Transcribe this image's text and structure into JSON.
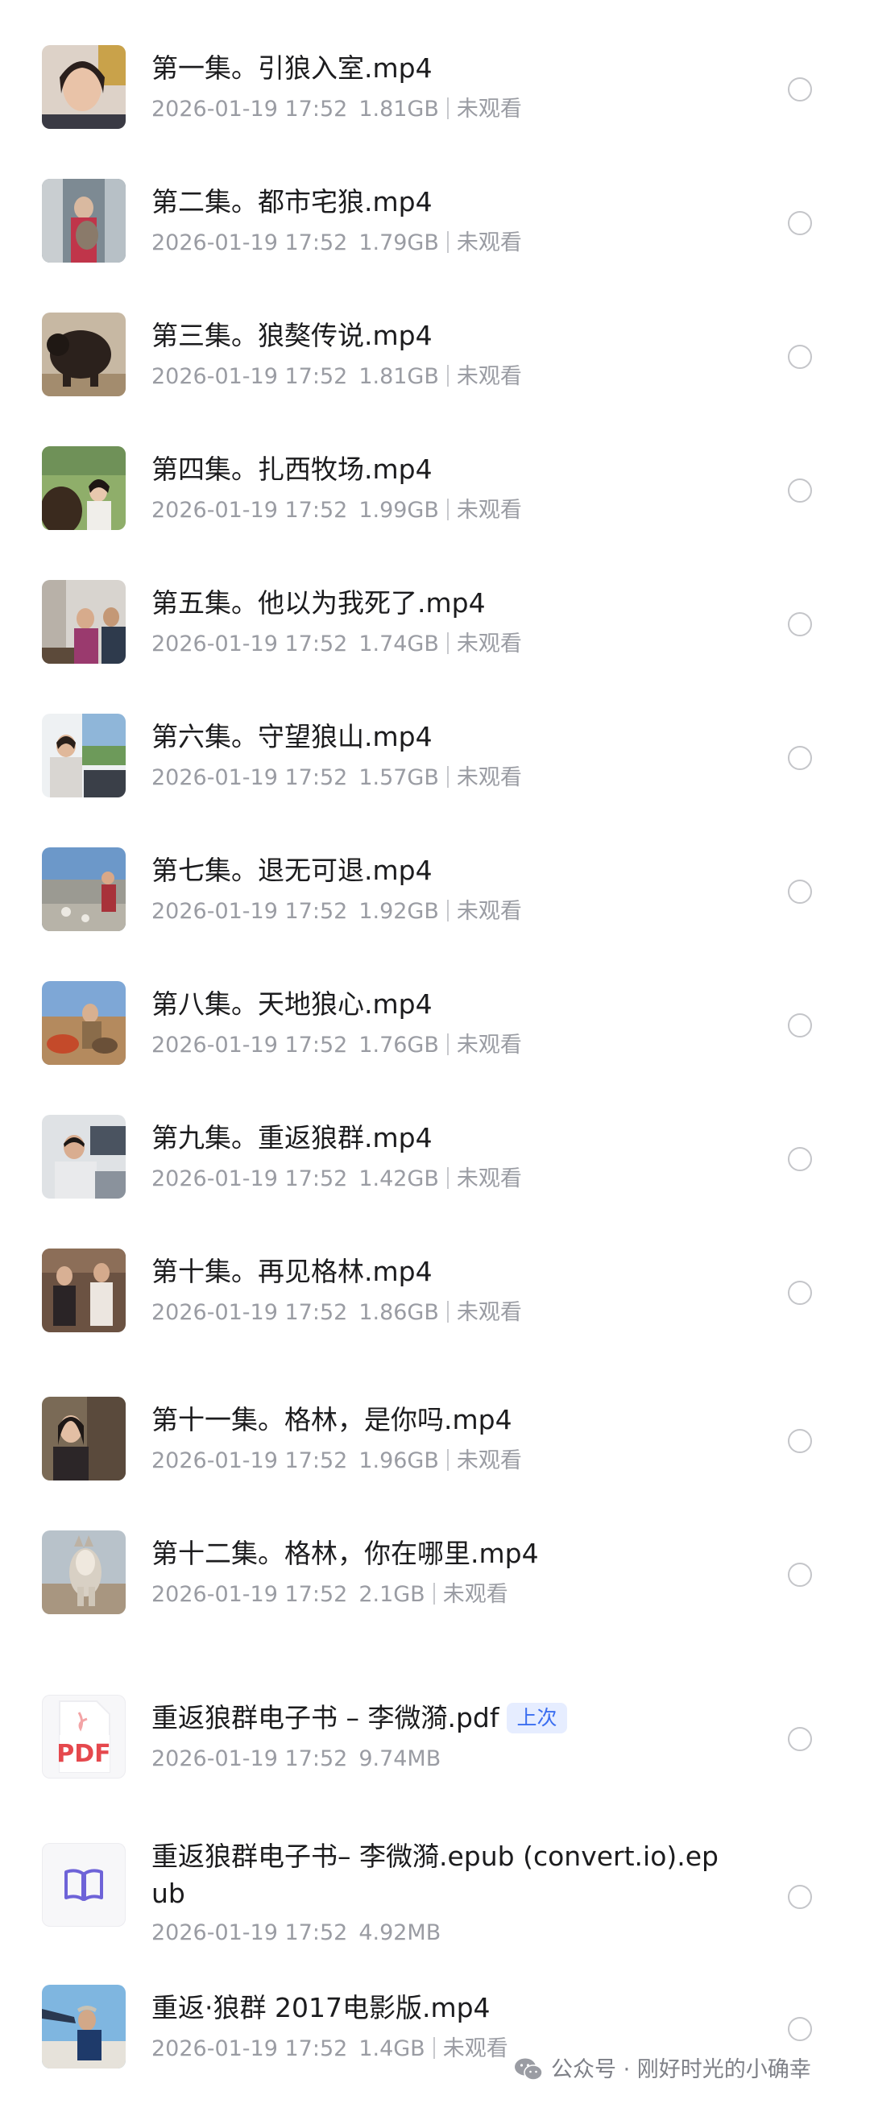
{
  "files": [
    {
      "title": "第一集。引狼入室.mp4",
      "date": "2026-01-19 17:52",
      "size": "1.81GB",
      "status": "未观看"
    },
    {
      "title": "第二集。都市宅狼.mp4",
      "date": "2026-01-19 17:52",
      "size": "1.79GB",
      "status": "未观看"
    },
    {
      "title": "第三集。狼獒传说.mp4",
      "date": "2026-01-19 17:52",
      "size": "1.81GB",
      "status": "未观看"
    },
    {
      "title": "第四集。扎西牧场.mp4",
      "date": "2026-01-19 17:52",
      "size": "1.99GB",
      "status": "未观看"
    },
    {
      "title": "第五集。他以为我死了.mp4",
      "date": "2026-01-19 17:52",
      "size": "1.74GB",
      "status": "未观看"
    },
    {
      "title": "第六集。守望狼山.mp4",
      "date": "2026-01-19 17:52",
      "size": "1.57GB",
      "status": "未观看"
    },
    {
      "title": "第七集。退无可退.mp4",
      "date": "2026-01-19 17:52",
      "size": "1.92GB",
      "status": "未观看"
    },
    {
      "title": "第八集。天地狼心.mp4",
      "date": "2026-01-19 17:52",
      "size": "1.76GB",
      "status": "未观看"
    },
    {
      "title": "第九集。重返狼群.mp4",
      "date": "2026-01-19 17:52",
      "size": "1.42GB",
      "status": "未观看"
    },
    {
      "title": "第十集。再见格林.mp4",
      "date": "2026-01-19 17:52",
      "size": "1.86GB",
      "status": "未观看"
    },
    {
      "title": "第十一集。格林，是你吗.mp4",
      "date": "2026-01-19 17:52",
      "size": "1.96GB",
      "status": "未观看"
    },
    {
      "title": "第十二集。格林，你在哪里.mp4",
      "date": "2026-01-19 17:52",
      "size": "2.1GB",
      "status": "未观看"
    },
    {
      "title": "重返狼群电子书 – 李微漪.pdf",
      "date": "2026-01-19 17:52",
      "size": "9.74MB",
      "tag": "上次",
      "icon_label": "PDF"
    },
    {
      "title": "重返狼群电子书– 李微漪.epub (convert.io).epub",
      "date": "2026-01-19 17:52",
      "size": "4.92MB"
    },
    {
      "title": "重返·狼群 2017电影版.mp4",
      "date": "2026-01-19 17:52",
      "size": "1.4GB",
      "status": "未观看"
    }
  ],
  "watermark": "公众号 · 刚好时光的小确幸",
  "colors": {
    "text": "#1c1c1e",
    "meta": "#9a9ca3",
    "tag": "#3b6ef0",
    "pdf": "#e5484d",
    "epub": "#6e63d8"
  }
}
